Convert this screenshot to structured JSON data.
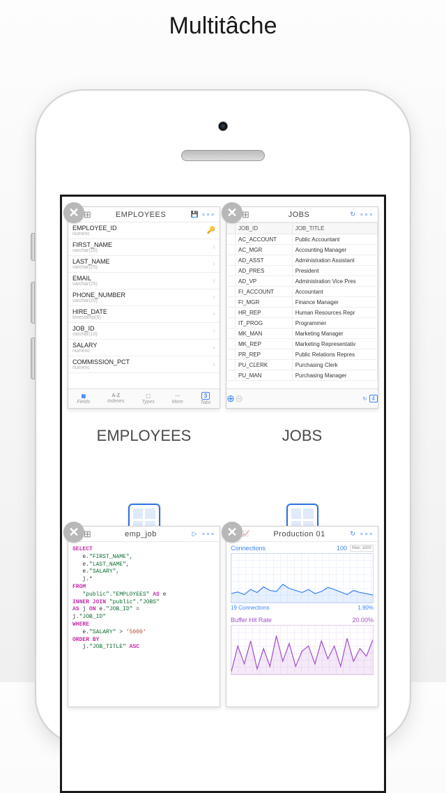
{
  "page_title": "Multitâche",
  "cards": {
    "employees": {
      "header_title": "EMPLOYEES",
      "label": "EMPLOYEES",
      "toolbar": {
        "fields": "Fields",
        "indexes": "Indexes",
        "types": "Types",
        "more": "More",
        "tabs": "Tabs",
        "tab_count": "3"
      },
      "fields": [
        {
          "name": "EMPLOYEE_ID",
          "type": "numeric"
        },
        {
          "name": "FIRST_NAME",
          "type": "varchar(20)"
        },
        {
          "name": "LAST_NAME",
          "type": "varchar(25)"
        },
        {
          "name": "EMAIL",
          "type": "varchar(25)"
        },
        {
          "name": "PHONE_NUMBER",
          "type": "varchar(20)"
        },
        {
          "name": "HIRE_DATE",
          "type": "timestamp(6)"
        },
        {
          "name": "JOB_ID",
          "type": "varchar(10)"
        },
        {
          "name": "SALARY",
          "type": "numeric"
        },
        {
          "name": "COMMISSION_PCT",
          "type": "numeric"
        }
      ]
    },
    "jobs": {
      "header_title": "JOBS",
      "label": "JOBS",
      "tab_count": "4",
      "columns": [
        "JOB_ID",
        "JOB_TITLE"
      ],
      "rows": [
        [
          "AC_ACCOUNT",
          "Public Accountant"
        ],
        [
          "AC_MGR",
          "Accounting Manager"
        ],
        [
          "AD_ASST",
          "Administration Assistant"
        ],
        [
          "AD_PRES",
          "President"
        ],
        [
          "AD_VP",
          "Administration Vice Pres"
        ],
        [
          "FI_ACCOUNT",
          "Accountant"
        ],
        [
          "FI_MGR",
          "Finance Manager"
        ],
        [
          "HR_REP",
          "Human Resources Repr"
        ],
        [
          "IT_PROG",
          "Programmer"
        ],
        [
          "MK_MAN",
          "Marketing Manager"
        ],
        [
          "MK_REP",
          "Marketing Representativ"
        ],
        [
          "PR_REP",
          "Public Relations Repres"
        ],
        [
          "PU_CLERK",
          "Purchasing Clerk"
        ],
        [
          "PU_MAN",
          "Purchasing Manager"
        ]
      ]
    },
    "empjob": {
      "header_title": "emp_job",
      "sql_keywords": {
        "select": "SELECT",
        "from": "FROM",
        "innerjoin": "INNER JOIN",
        "on": "ON",
        "as": "AS",
        "where": "WHERE",
        "orderby": "ORDER BY",
        "asc": "ASC"
      },
      "sql_cols": {
        "first": "\"FIRST_NAME\"",
        "last": "\"LAST_NAME\"",
        "salary": "\"SALARY\"",
        "jobid": "\"JOB_ID\"",
        "jobtitle": "\"JOB_TITLE\""
      },
      "sql_tables": {
        "emp": "\"public\".\"EMPLOYEES\"",
        "jobs": "\"public\".\"JOBS\""
      },
      "sql_val": "'5000'"
    },
    "production": {
      "header_title": "Production 01",
      "conn_label": "Connections",
      "conn_value": "100",
      "conn_max": "Max:\n1000",
      "conn_footer_left": "19 Connections",
      "conn_footer_right": "1.90%",
      "buf_label": "Buffer Hit Rate",
      "buf_value": "20.00%"
    }
  },
  "chart_data": [
    {
      "type": "line",
      "title": "Connections",
      "ylim": [
        0,
        100
      ],
      "y_max_reference": 1000,
      "values": [
        22,
        25,
        20,
        30,
        24,
        35,
        28,
        26,
        40,
        32,
        28,
        24,
        30,
        22,
        26,
        34,
        30,
        25,
        20,
        28,
        24,
        22,
        19
      ],
      "footer_value": 19,
      "footer_pct": 1.9
    },
    {
      "type": "line",
      "title": "Buffer Hit Rate",
      "ylim": [
        0,
        100
      ],
      "values": [
        10,
        60,
        25,
        70,
        15,
        55,
        20,
        80,
        30,
        65,
        20,
        50,
        60,
        25,
        70,
        35,
        60,
        20,
        75,
        30,
        55,
        40,
        72
      ],
      "footer_pct": 20.0
    }
  ]
}
